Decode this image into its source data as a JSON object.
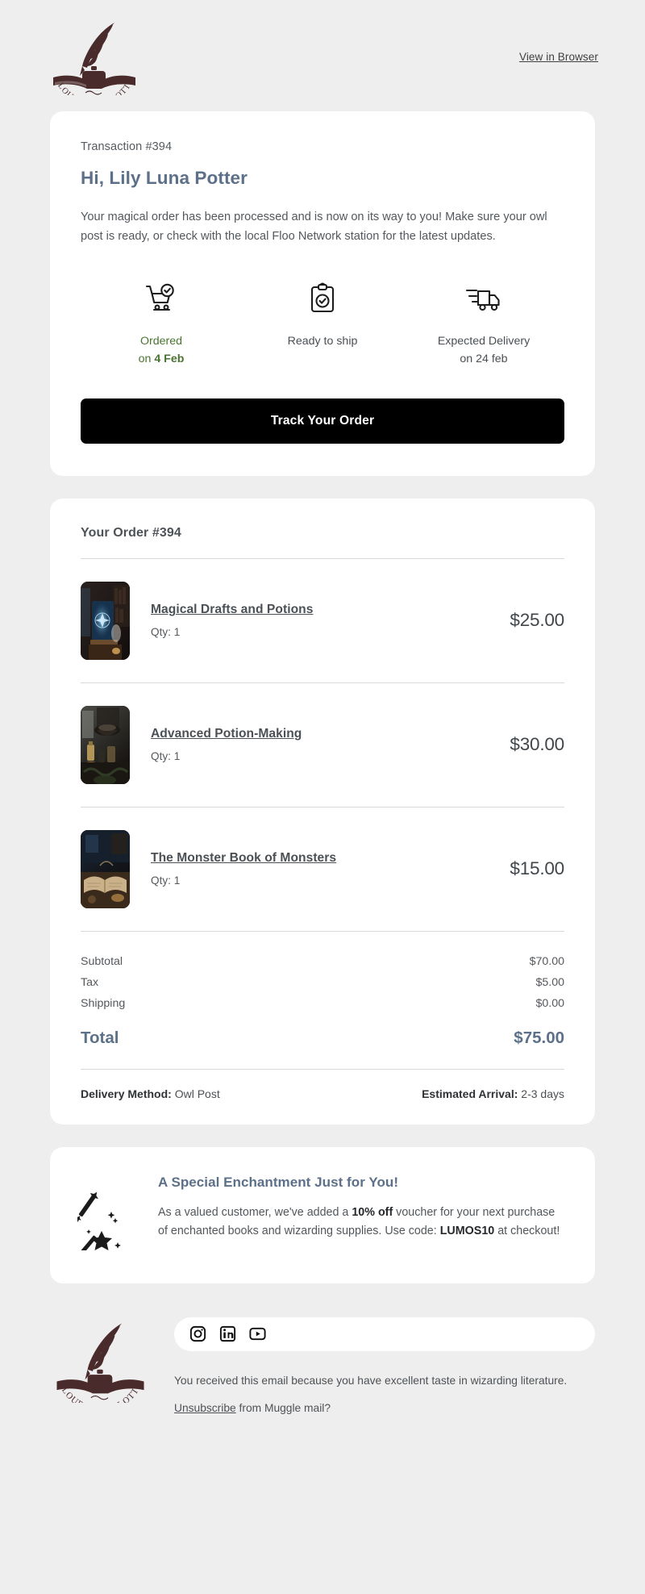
{
  "header": {
    "logo_alt": "Flourish & Blotts",
    "brand_name": "FLOURISH & BLOTTS",
    "view_in_browser": "View in Browser"
  },
  "status_card": {
    "transaction": "Transaction #394",
    "greeting": "Hi, Lily Luna Potter",
    "intro": "Your magical order has been processed and is now on its way to you! Make sure your owl post is ready, or check with the local Floo Network station for the latest updates.",
    "steps": [
      {
        "icon": "cart-check-icon",
        "line1": "Ordered",
        "line2_prefix": "on ",
        "line2_bold": "4 Feb",
        "state": "done"
      },
      {
        "icon": "clipboard-check-icon",
        "line1": "Ready to ship",
        "line2_prefix": "",
        "line2_bold": "",
        "state": "pending"
      },
      {
        "icon": "delivery-truck-icon",
        "line1": "Expected Delivery",
        "line2_prefix": "on 24 feb",
        "line2_bold": "",
        "state": "pending"
      }
    ],
    "track_button": "Track Your Order"
  },
  "order_card": {
    "title": "Your Order #394",
    "qty_prefix": "Qty: ",
    "items": [
      {
        "name": "Magical Drafts and Potions",
        "qty": "Qty: 1",
        "price": "$25.00",
        "thumb": "glowing-spellbook-library"
      },
      {
        "name": "Advanced Potion-Making",
        "qty": "Qty: 1",
        "price": "$30.00",
        "thumb": "potion-workshop"
      },
      {
        "name": "The Monster Book of Monsters",
        "qty": "Qty: 1",
        "price": "$15.00",
        "thumb": "open-book-desk"
      }
    ],
    "totals": [
      {
        "label": "Subtotal",
        "value": "$70.00"
      },
      {
        "label": "Tax",
        "value": "$5.00"
      },
      {
        "label": "Shipping",
        "value": "$0.00"
      }
    ],
    "grand_total": {
      "label": "Total",
      "value": "$75.00"
    },
    "delivery_method_label": "Delivery Method:",
    "delivery_method_value": " Owl Post",
    "estimated_arrival_label": "Estimated Arrival:",
    "estimated_arrival_value": " 2-3 days"
  },
  "promo_card": {
    "icon": "magic-wand-sparkles-icon",
    "title": "A Special Enchantment Just for You!",
    "text_part1": "As a valued customer, we've added a ",
    "discount": "10% off",
    "text_part2": " voucher for your next purchase of enchanted books and wizarding supplies. Use code: ",
    "code": "LUMOS10",
    "text_part3": " at checkout!"
  },
  "footer": {
    "brand_name": "FLOURISH & BLOTTS",
    "socials": [
      {
        "name": "instagram-icon",
        "label": "Instagram"
      },
      {
        "name": "linkedin-icon",
        "label": "LinkedIn"
      },
      {
        "name": "youtube-icon",
        "label": "YouTube"
      }
    ],
    "note": "You received this email because you have excellent taste in wizarding literature.",
    "unsubscribe_link": "Unsubscribe",
    "unsubscribe_rest": " from Muggle mail?"
  },
  "colors": {
    "page_bg": "#eeeeee",
    "card_bg": "#ffffff",
    "accent_blue": "#5c7089",
    "success_green": "#4a7330",
    "button_bg": "#000000",
    "brand_maroon": "#4a2b2b"
  }
}
